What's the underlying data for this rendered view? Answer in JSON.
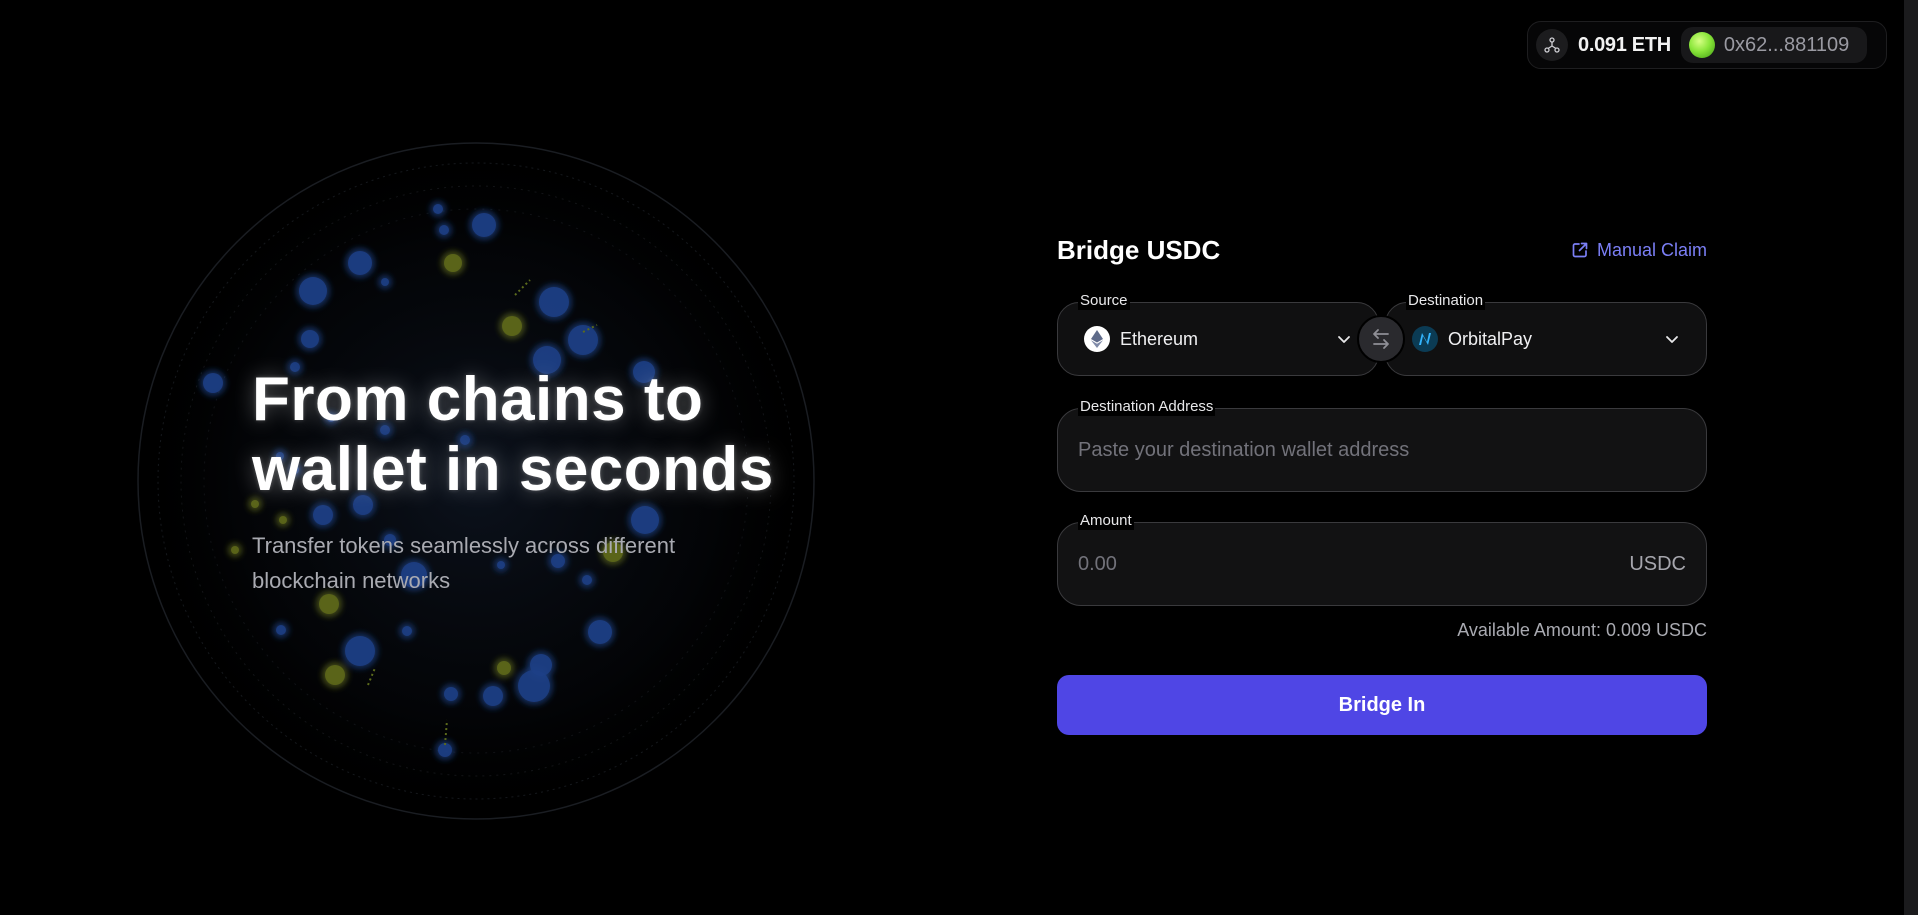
{
  "wallet": {
    "balance": "0.091 ETH",
    "address": "0x62...881109",
    "network_icon": "network-icon",
    "avatar_color": "#8ae63a"
  },
  "hero": {
    "title": "From chains to wallet in seconds",
    "subtitle": "Transfer tokens seamlessly across different blockchain networks"
  },
  "bridge": {
    "title": "Bridge USDC",
    "manual_claim_label": "Manual Claim",
    "source": {
      "label": "Source",
      "value": "Ethereum",
      "icon": "ethereum-icon"
    },
    "destination": {
      "label": "Destination",
      "value": "OrbitalPay",
      "icon": "orbitalpay-icon"
    },
    "destination_address": {
      "label": "Destination Address",
      "placeholder": "Paste your destination wallet address",
      "value": ""
    },
    "amount": {
      "label": "Amount",
      "placeholder": "0.00",
      "unit": "USDC",
      "value": ""
    },
    "available_text": "Available Amount: 0.009 USDC",
    "submit_label": "Bridge In"
  },
  "colors": {
    "accent": "#4f46e5",
    "link": "#7b7ff6",
    "background": "#000000"
  }
}
